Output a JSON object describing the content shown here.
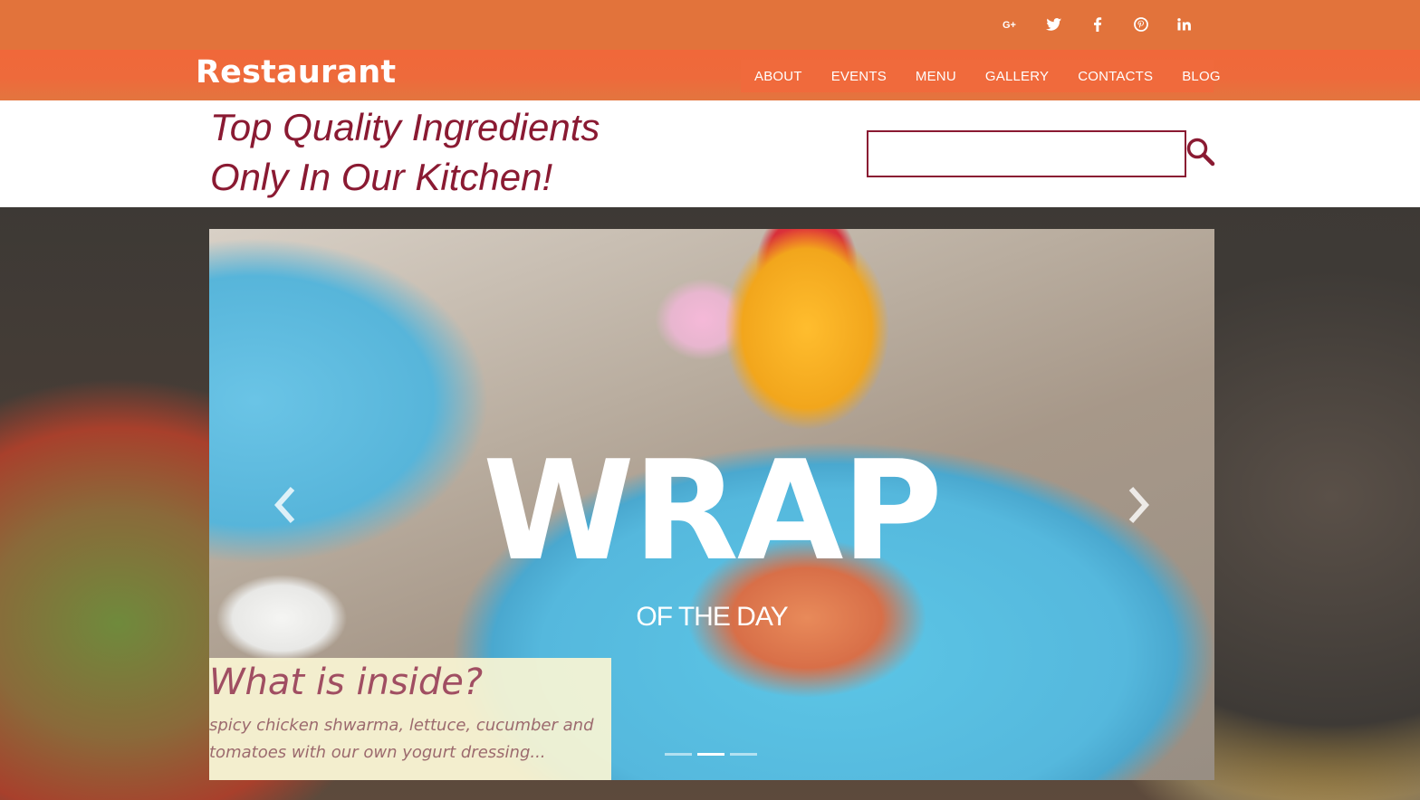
{
  "brand": {
    "name": "Restaurant"
  },
  "social": [
    {
      "name": "google-plus-icon",
      "label": "G+"
    },
    {
      "name": "twitter-icon",
      "label": ""
    },
    {
      "name": "facebook-icon",
      "label": "f"
    },
    {
      "name": "pinterest-icon",
      "label": ""
    },
    {
      "name": "linkedin-icon",
      "label": "in"
    }
  ],
  "nav": {
    "items": [
      "ABOUT",
      "EVENTS",
      "MENU",
      "GALLERY",
      "CONTACTS",
      "BLOG"
    ]
  },
  "tagline": {
    "line1": "Top Quality Ingredients",
    "line2": "Only In Our Kitchen!"
  },
  "search": {
    "value": "",
    "placeholder": ""
  },
  "slider": {
    "title": "WRAP",
    "subtitle": "OF THE DAY",
    "info_title": "What is inside?",
    "info_text": "spicy chicken shwarma, lettuce, cucumber and tomatoes with our own yogurt dressing...",
    "slide_count": 3,
    "active_slide": 2
  },
  "colors": {
    "topbar": "#e2733b",
    "navbar": "#f0683a",
    "tagline": "#8a1a32",
    "info_title": "#a04e62"
  }
}
